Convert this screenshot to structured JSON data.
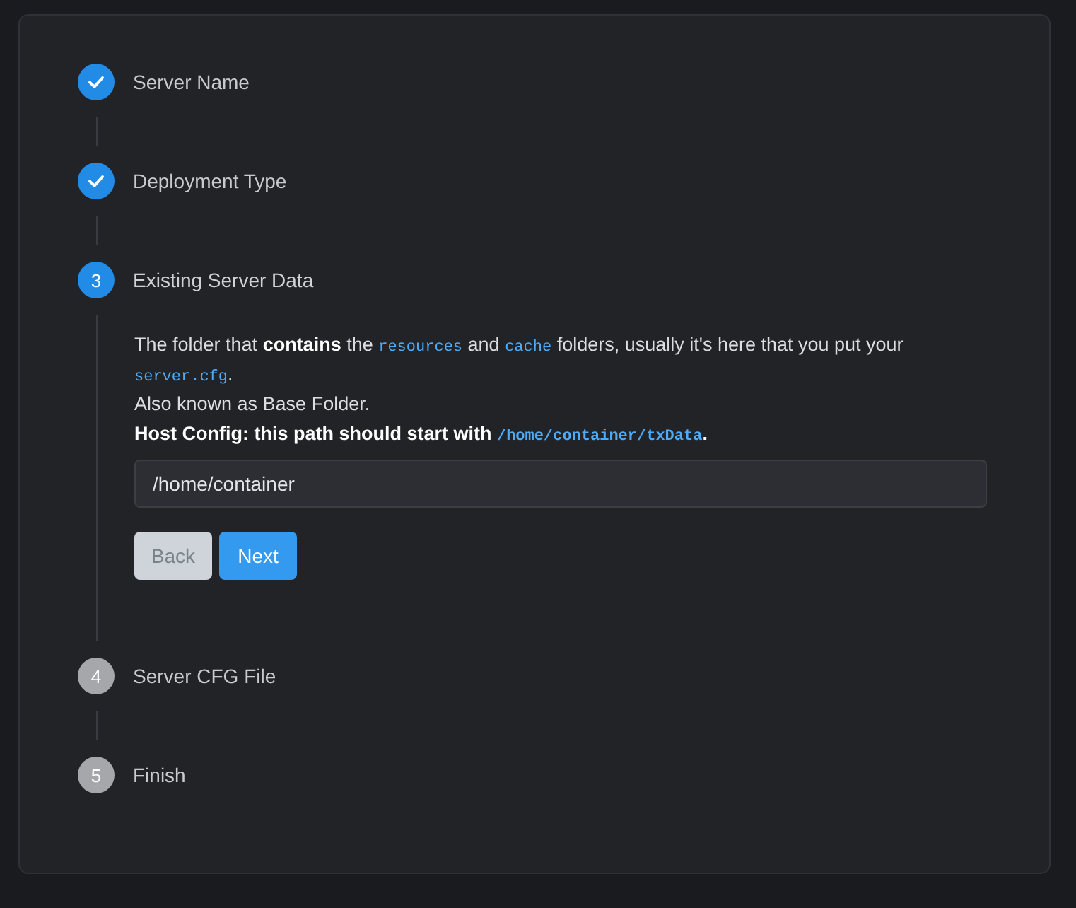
{
  "steps": [
    {
      "label": "Server Name",
      "completed": true,
      "selected": false
    },
    {
      "label": "Deployment Type",
      "completed": true,
      "selected": false
    },
    {
      "label": "Existing Server Data",
      "completed": false,
      "selected": true,
      "number": "3",
      "content": {
        "paragraphs": [
          {
            "bold": false,
            "parts": [
              {
                "kind": "text",
                "text": "The folder that **contains** the "
              },
              {
                "kind": "code",
                "text": "resources"
              },
              {
                "kind": "text",
                "text": " and "
              },
              {
                "kind": "code",
                "text": "cache"
              },
              {
                "kind": "text",
                "text": " folders, usually it's here that you put your "
              },
              {
                "kind": "code",
                "text": "server.cfg"
              },
              {
                "kind": "text",
                "text": "."
              }
            ]
          },
          {
            "bold": false,
            "parts": [
              {
                "kind": "text",
                "text": "Also known as Base Folder."
              }
            ]
          },
          {
            "bold": true,
            "parts": [
              {
                "kind": "text",
                "text": "Host Config: this path should start with "
              },
              {
                "kind": "code",
                "text": "/home/container/txData"
              },
              {
                "kind": "text",
                "text": "."
              }
            ]
          }
        ],
        "field": {
          "value": "/home/container"
        },
        "buttons": [
          {
            "label": "Back",
            "disabled": true
          },
          {
            "label": "Next",
            "disabled": false
          }
        ]
      }
    },
    {
      "label": "Server CFG File",
      "completed": false,
      "selected": false,
      "number": "4"
    },
    {
      "label": "Finish",
      "completed": false,
      "selected": false,
      "number": "5"
    }
  ]
}
